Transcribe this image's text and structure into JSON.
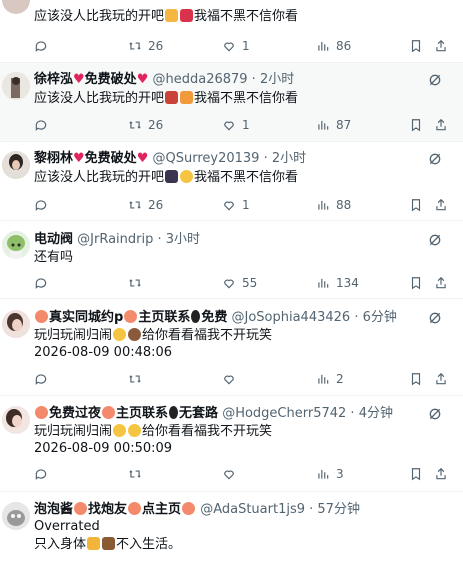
{
  "tweets": [
    {
      "name": "",
      "handle": "",
      "time": "",
      "text": [
        "应该没人比我玩的开吧",
        "我福不黑不信你看"
      ],
      "stats": {
        "replies": "",
        "retweets": "26",
        "likes": "1",
        "views": "86"
      }
    },
    {
      "name": "徐梓泓",
      "badge": "免费破处",
      "handle": "@hedda26879",
      "time": "2小时",
      "text": [
        "应该没人比我玩的开吧",
        "我福不黑不信你看"
      ],
      "stats": {
        "replies": "",
        "retweets": "26",
        "likes": "1",
        "views": "87"
      }
    },
    {
      "name": "黎栩林",
      "badge": "免费破处",
      "handle": "@QSurrey20139",
      "time": "2小时",
      "text": [
        "应该没人比我玩的开吧",
        "我福不黑不信你看"
      ],
      "stats": {
        "replies": "",
        "retweets": "26",
        "likes": "1",
        "views": "88"
      }
    },
    {
      "name": "电动阀",
      "handle": "@JrRaindrip",
      "time": "3小时",
      "text": [
        "还有吗"
      ],
      "stats": {
        "replies": "",
        "retweets": "",
        "likes": "55",
        "views": "134"
      }
    },
    {
      "name": "真实同城约p",
      "badge": "主页联系",
      "badge2": "免费",
      "handle": "@JoSophia443426",
      "time": "6分钟",
      "text": [
        "玩归玩闹归闹",
        "给你看看福我不开玩笑"
      ],
      "timestamp": "2026-08-09 00:48:06",
      "stats": {
        "replies": "",
        "retweets": "",
        "likes": "",
        "views": "2"
      }
    },
    {
      "name": "免费过夜",
      "badge": "主页联系",
      "badge2": "无套路",
      "handle": "@HodgeCherr5742",
      "time": "4分钟",
      "text": [
        "玩归玩闹归闹",
        "给你看看福我不开玩笑"
      ],
      "timestamp": "2026-08-09 00:50:09",
      "stats": {
        "replies": "",
        "retweets": "",
        "likes": "",
        "views": "3"
      }
    },
    {
      "name": "泡泡酱",
      "badge": "找炮友",
      "badge2": "点主页",
      "handle": "@AdaStuart1js9",
      "time": "57分钟",
      "text": [
        "Overrated",
        "只入身体",
        "不入生活。"
      ]
    }
  ],
  "colors": {
    "accent": "#1d9bf0",
    "muted": "#536471",
    "border": "#eff3f4",
    "heart": "#e0245e"
  }
}
